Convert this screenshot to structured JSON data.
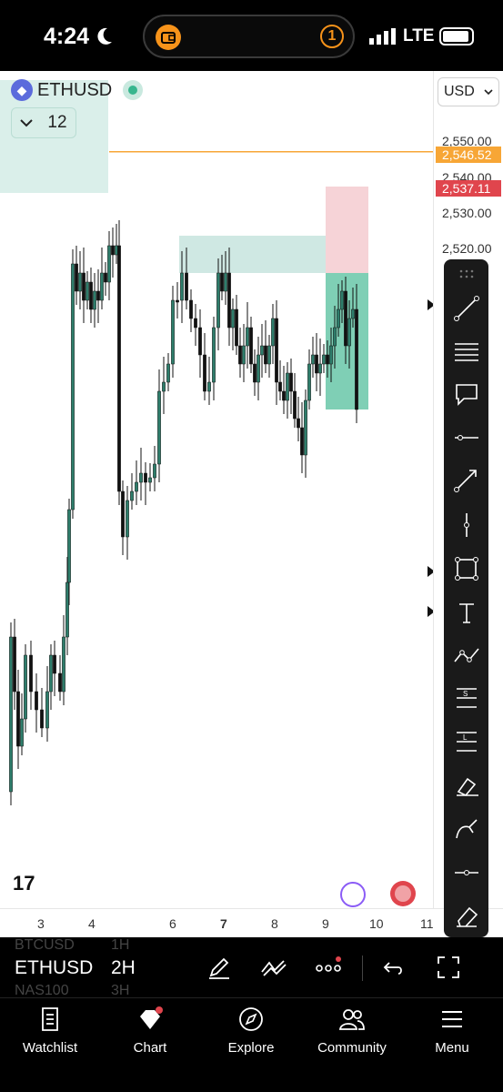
{
  "status_bar": {
    "time": "4:24",
    "network": "LTE",
    "badge": "1"
  },
  "chart_header": {
    "symbol": "ETHUSD",
    "indicator_count": "12"
  },
  "price_scale": {
    "currency": "USD",
    "ticks": [
      "2,550.00",
      "2,540.00",
      "2,530.00",
      "2,520.00"
    ],
    "tags": [
      {
        "label": "2,546.52",
        "color": "#f7a636"
      },
      {
        "label": "2,537.11",
        "color": "#e0454d"
      }
    ]
  },
  "time_axis": {
    "ticks": [
      "3",
      "4",
      "6",
      "7",
      "8",
      "9",
      "10",
      "11"
    ]
  },
  "bottom_bar": {
    "symbol": "ETHUSD",
    "interval": "2H",
    "ghost_symbols": [
      "BTCUSD",
      "NAS100"
    ],
    "ghost_intervals": [
      "1H",
      "3H"
    ]
  },
  "tabs": [
    {
      "label": "Watchlist",
      "icon": "watchlist-icon"
    },
    {
      "label": "Chart",
      "icon": "chart-icon"
    },
    {
      "label": "Explore",
      "icon": "compass-icon"
    },
    {
      "label": "Community",
      "icon": "community-icon"
    },
    {
      "label": "Menu",
      "icon": "menu-icon"
    }
  ],
  "drawing_tools": [
    "trend-line",
    "fib-retracement",
    "callout",
    "horizontal-ray",
    "arrow",
    "vertical-line",
    "rectangle",
    "text",
    "path",
    "short-position",
    "long-position",
    "brush",
    "highlighter",
    "cross-line",
    "eraser"
  ],
  "chart_data": {
    "type": "candlestick",
    "symbol": "ETHUSD",
    "interval": "2H",
    "ylim": [
      2440,
      2555
    ],
    "horizontal_line": 2546.52,
    "last_price": 2537.11
  }
}
